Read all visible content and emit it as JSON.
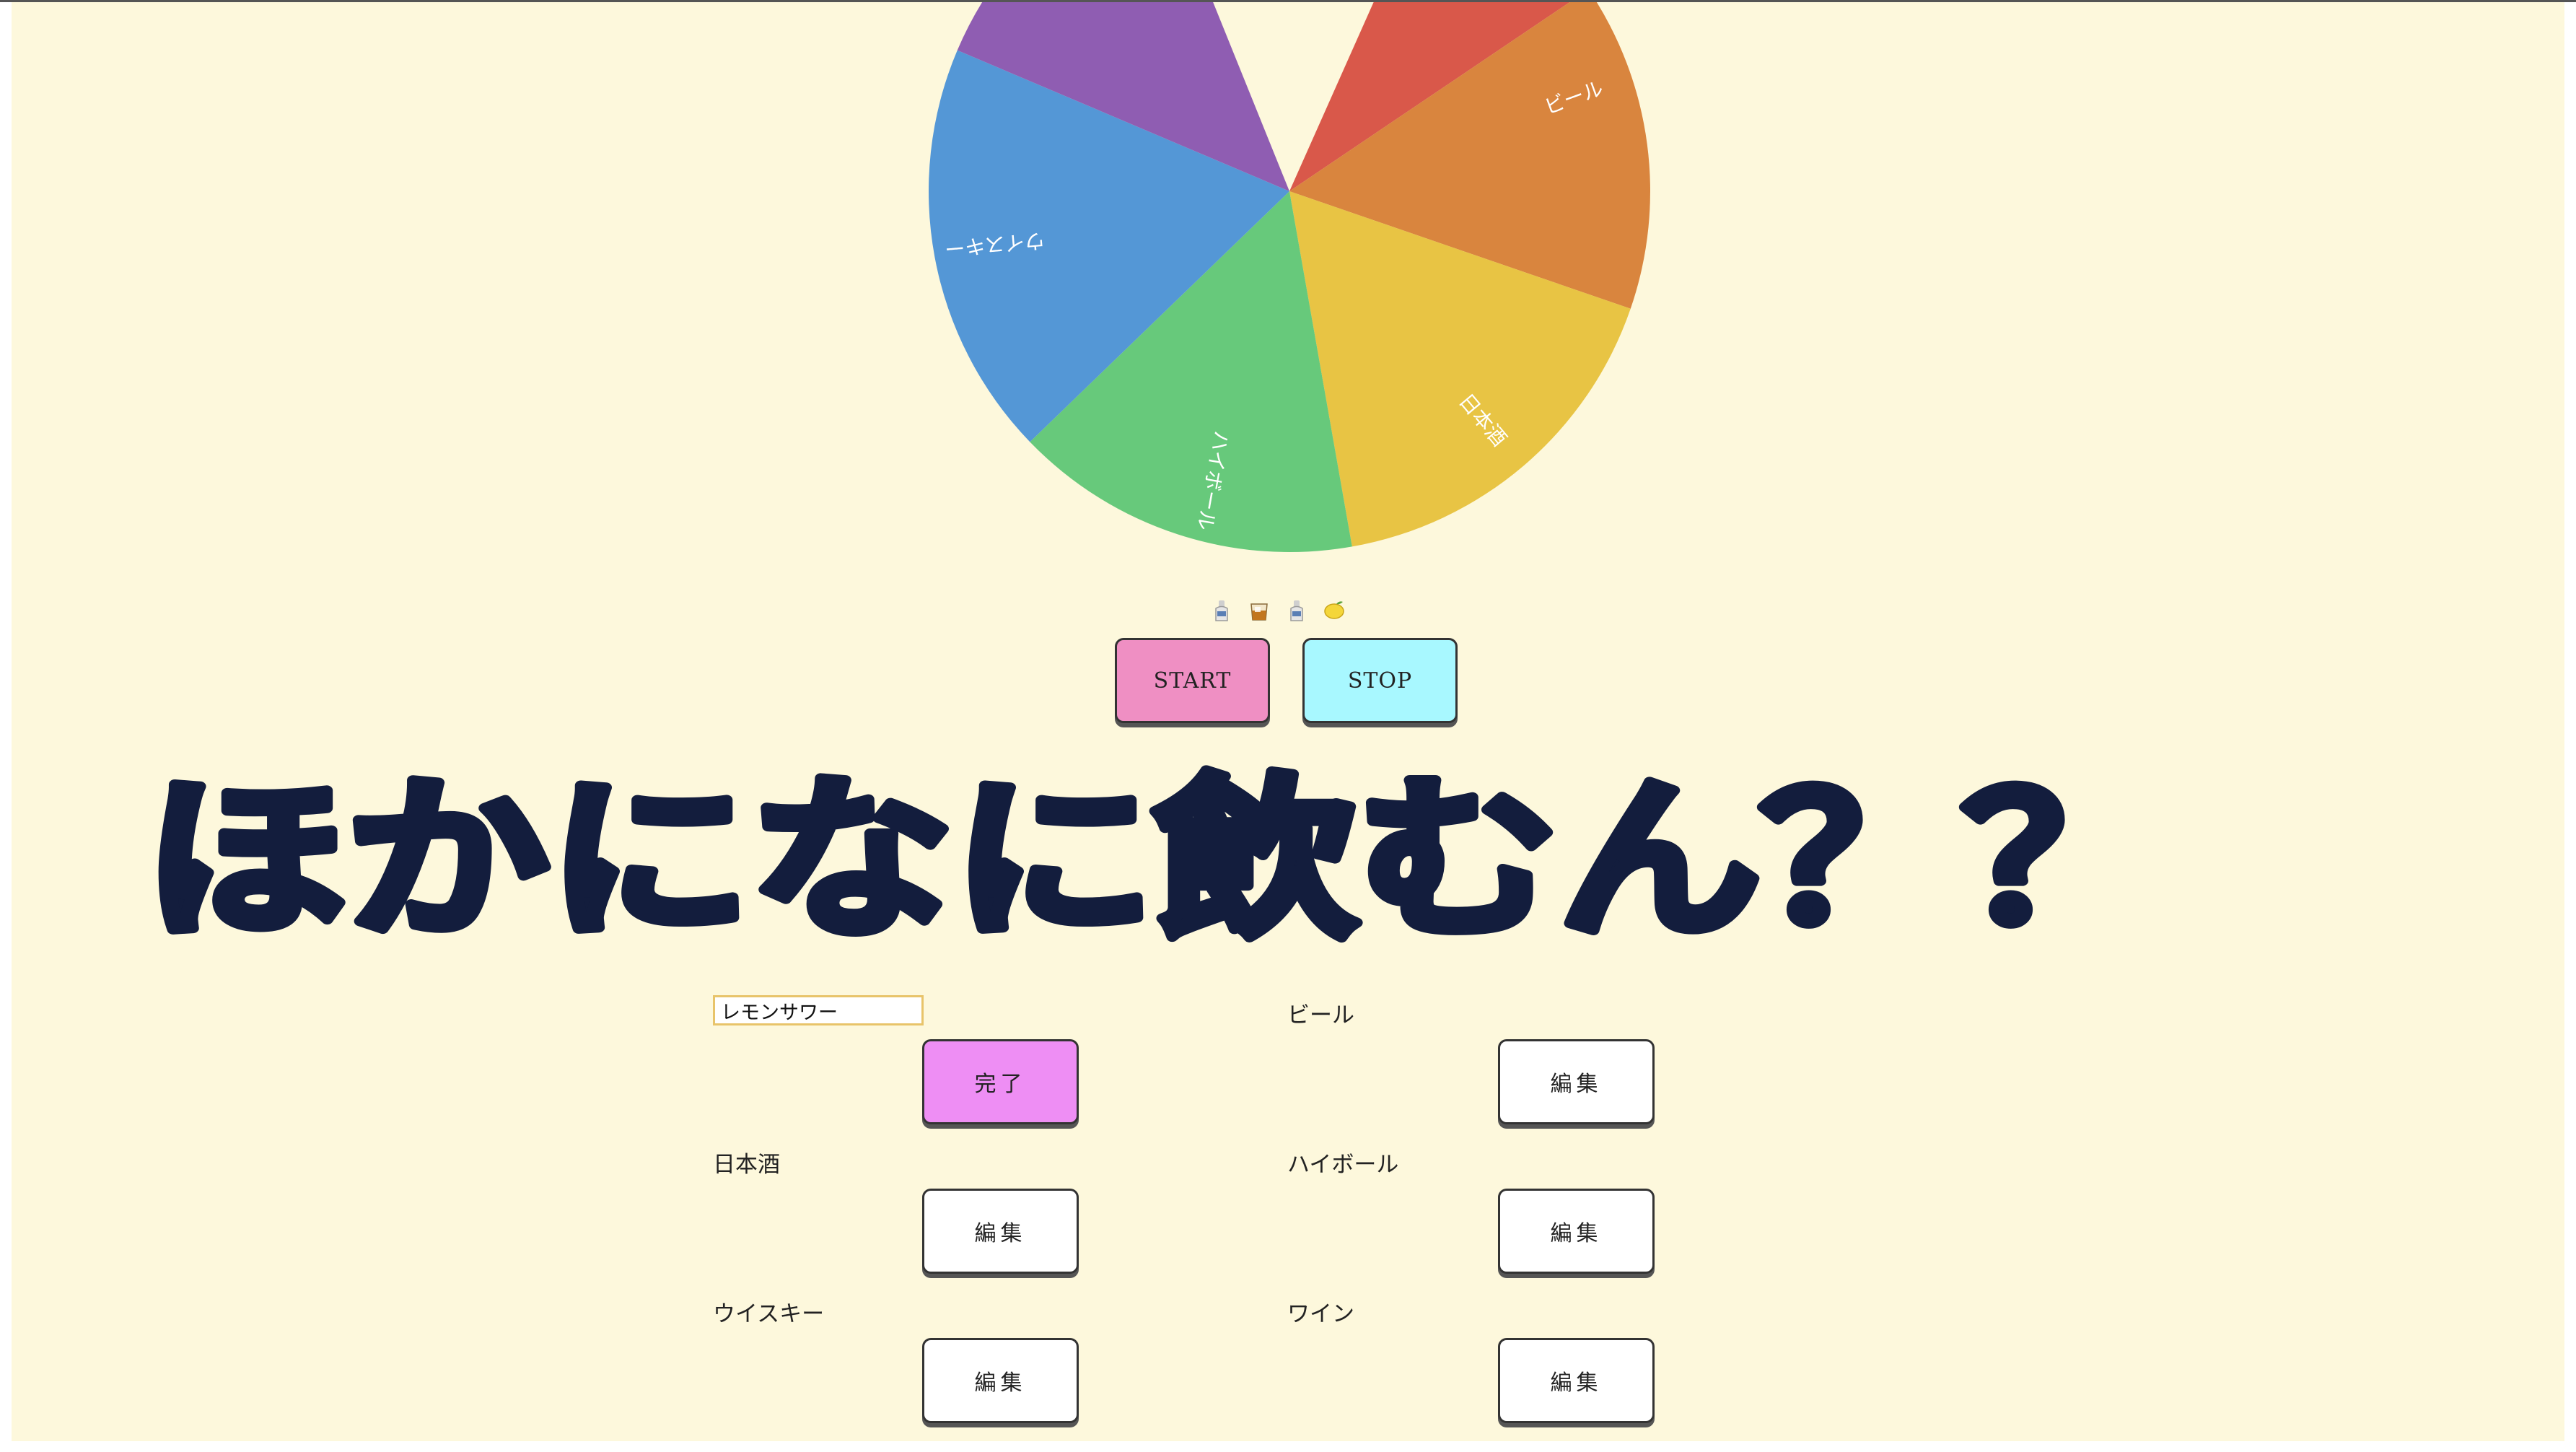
{
  "wheel": {
    "segments": [
      {
        "label": "",
        "color": "#d9584a"
      },
      {
        "label": "ビール",
        "color": "#d9853e"
      },
      {
        "label": "日本酒",
        "color": "#e8c444"
      },
      {
        "label": "ハイボール",
        "color": "#67c97b"
      },
      {
        "label": "ウイスキー",
        "color": "#5497d6"
      },
      {
        "label": "",
        "color": "#8f5db2"
      }
    ]
  },
  "emoji_icons": [
    "sake-bottle-icon",
    "whisky-glass-icon",
    "sake-bottle-icon",
    "lemon-icon"
  ],
  "controls": {
    "start_label": "START",
    "stop_label": "STOP"
  },
  "title": "ほかになに飲むん？？",
  "items": [
    {
      "label": "",
      "input_value": "レモンサワー",
      "button_label": "完了",
      "editing": true
    },
    {
      "label": "ビール",
      "button_label": "編集"
    },
    {
      "label": "日本酒",
      "button_label": "編集"
    },
    {
      "label": "ハイボール",
      "button_label": "編集"
    },
    {
      "label": "ウイスキー",
      "button_label": "編集"
    },
    {
      "label": "ワイン",
      "button_label": "編集"
    }
  ],
  "colors": {
    "background": "#fdf8dc",
    "title": "#131d3d",
    "start": "#ef8fc3",
    "stop": "#a8f8ff",
    "done": "#ee8ef4"
  }
}
